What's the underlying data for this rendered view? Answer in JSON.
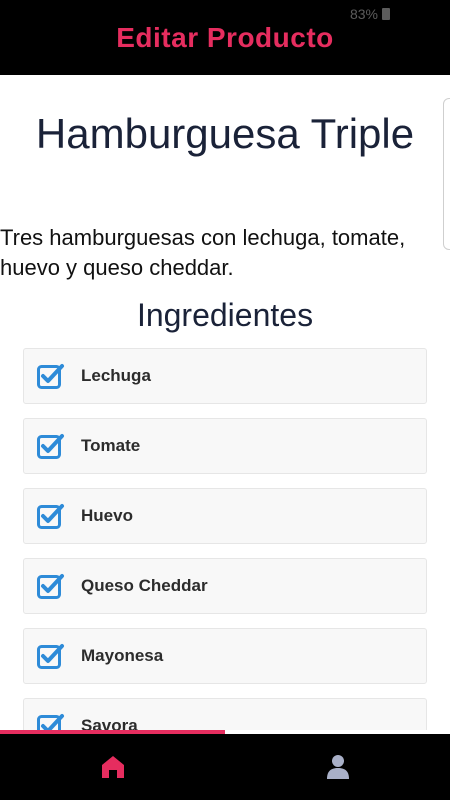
{
  "status_bar": {
    "battery": "83%"
  },
  "header": {
    "title": "Editar Producto"
  },
  "product": {
    "name": "Hamburguesa Triple",
    "description": "Tres hamburguesas con lechuga, tomate, huevo y queso cheddar."
  },
  "ingredients": {
    "title": "Ingredientes",
    "items": [
      {
        "label": "Lechuga",
        "checked": true
      },
      {
        "label": "Tomate",
        "checked": true
      },
      {
        "label": "Huevo",
        "checked": true
      },
      {
        "label": "Queso Cheddar",
        "checked": true
      },
      {
        "label": "Mayonesa",
        "checked": true
      },
      {
        "label": "Savora",
        "checked": true
      }
    ]
  },
  "nav": {
    "items": [
      {
        "icon": "home-icon",
        "active": true
      },
      {
        "icon": "user-icon",
        "active": false
      }
    ],
    "active_color": "#e62d5f",
    "inactive_color": "#a9b0c8"
  },
  "colors": {
    "accent": "#e62d5f",
    "checkbox": "#2e8bd8",
    "header_bg": "#000000"
  }
}
